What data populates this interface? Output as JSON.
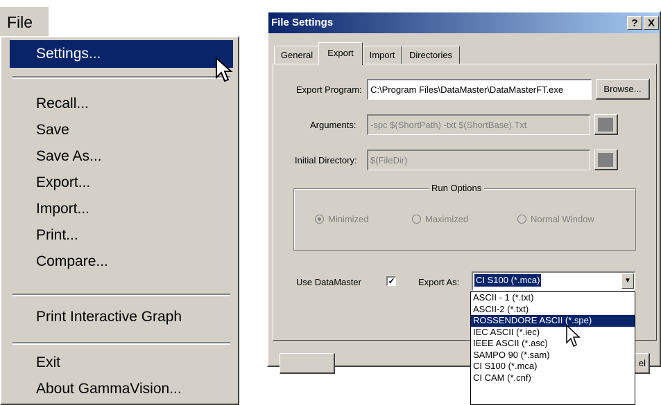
{
  "file_menu": {
    "title": "File",
    "items": [
      {
        "label": "Settings...",
        "selected": true
      },
      {
        "label": "Recall..."
      },
      {
        "label": "Save"
      },
      {
        "label": "Save As..."
      },
      {
        "label": "Export..."
      },
      {
        "label": "Import..."
      },
      {
        "label": "Print..."
      },
      {
        "label": "Compare..."
      },
      {
        "label": "Print Interactive Graph"
      },
      {
        "label": "Exit"
      },
      {
        "label": "About GammaVision..."
      }
    ]
  },
  "dialog": {
    "title": "File Settings",
    "help_label": "?",
    "close_label": "X",
    "tabs": [
      {
        "label": "General"
      },
      {
        "label": "Export",
        "active": true
      },
      {
        "label": "Import"
      },
      {
        "label": "Directories"
      }
    ],
    "export_program": {
      "label": "Export Program:",
      "value": "C:\\Program Files\\DataMaster\\DataMasterFT.exe"
    },
    "browse_label": "Browse...",
    "arguments": {
      "label": "Arguments:",
      "value": "-spc $(ShortPath) -txt $(ShortBase).Txt"
    },
    "initial_directory": {
      "label": "Initial Directory:",
      "value": "$(FileDir)"
    },
    "run_options": {
      "legend": "Run Options",
      "options": [
        {
          "label": "Minimized",
          "checked": true
        },
        {
          "label": "Maximized",
          "checked": false
        },
        {
          "label": "Normal Window",
          "checked": false
        }
      ]
    },
    "use_datamaster": {
      "label": "Use DataMaster",
      "checked": true,
      "mark": "✓"
    },
    "export_as": {
      "label": "Export As:",
      "selected": "CI S100 (*.mca)",
      "options": [
        {
          "label": "ASCII - 1 (*.txt)"
        },
        {
          "label": "ASCII-2 (*.txt)"
        },
        {
          "label": "ROSSENDORE ASCII (*.spe)",
          "highlighted": true
        },
        {
          "label": "IEC ASCII (*.iec)"
        },
        {
          "label": "IEEE ASCII (*.asc)"
        },
        {
          "label": "SAMPO 90 (*.sam)"
        },
        {
          "label": "CI S100 (*.mca)"
        },
        {
          "label": "CI CAM (*.cnf)"
        }
      ]
    },
    "ok_label": "",
    "cancel_label": "el",
    "colors": {
      "titlebar": "#0a246a",
      "face": "#d4d0c8",
      "highlight": "#0a246a"
    }
  },
  "icons": {
    "cursor": "arrow-pointer-icon",
    "dropdown_arrow": "chevron-down-icon"
  }
}
